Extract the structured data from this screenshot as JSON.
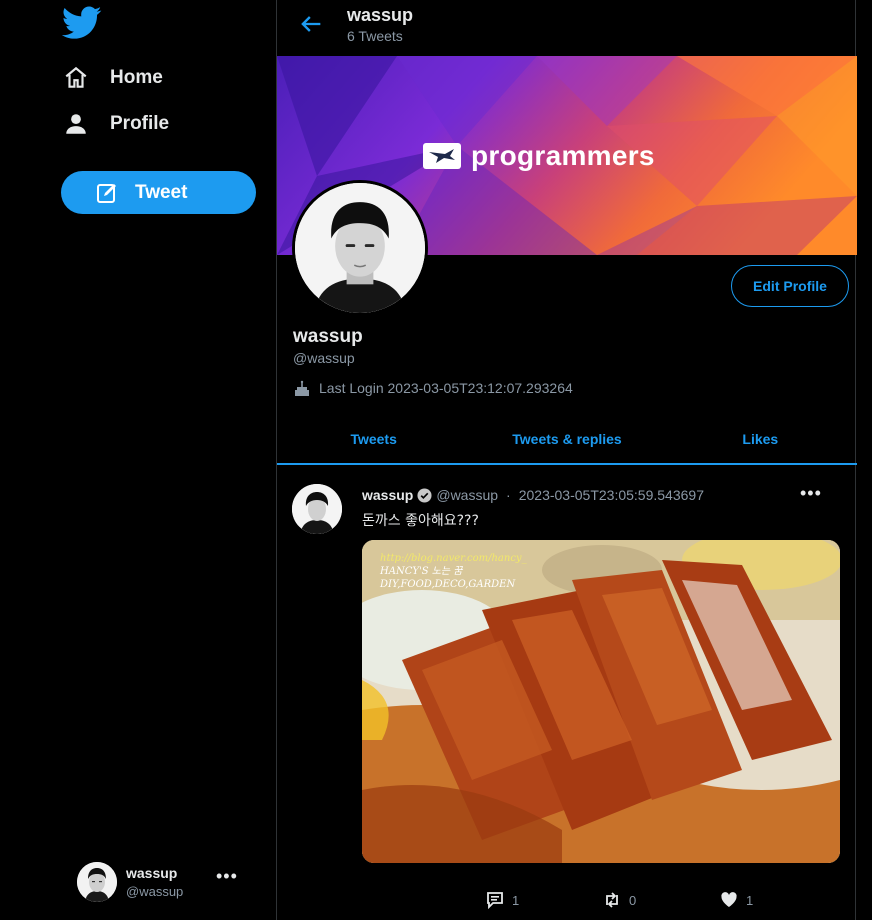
{
  "app": {
    "accent": "#1d9bf0",
    "background": "#000000"
  },
  "sidebar": {
    "logo_icon": "twitter-bird-icon",
    "items": [
      {
        "label": "Home",
        "icon": "home-icon"
      },
      {
        "label": "Profile",
        "icon": "person-icon"
      }
    ],
    "tweet_button": {
      "label": "Tweet",
      "icon": "compose-icon"
    },
    "account": {
      "name": "wassup",
      "handle": "@wassup",
      "more": "•••"
    }
  },
  "header": {
    "title": "wassup",
    "subtitle": "6 Tweets",
    "back_icon": "arrow-left-icon"
  },
  "banner": {
    "brand": "programmers"
  },
  "profile": {
    "name": "wassup",
    "handle": "@wassup",
    "last_login": "Last Login 2023-03-05T23:12:07.293264",
    "edit_label": "Edit Profile"
  },
  "tabs": [
    {
      "label": "Tweets"
    },
    {
      "label": "Tweets & replies"
    },
    {
      "label": "Likes"
    }
  ],
  "tweet": {
    "name": "wassup",
    "handle": "@wassup",
    "dot": "·",
    "time": "2023-03-05T23:05:59.543697",
    "text": "돈까스 좋아해요???",
    "more": "•••",
    "image_watermark": [
      "http://blog.naver.com/hancy_",
      "HANCY'S 노는 꿈",
      "DIY,FOOD,DECO,GARDEN"
    ],
    "actions": {
      "replies": "1",
      "retweets": "0",
      "likes": "1"
    }
  }
}
